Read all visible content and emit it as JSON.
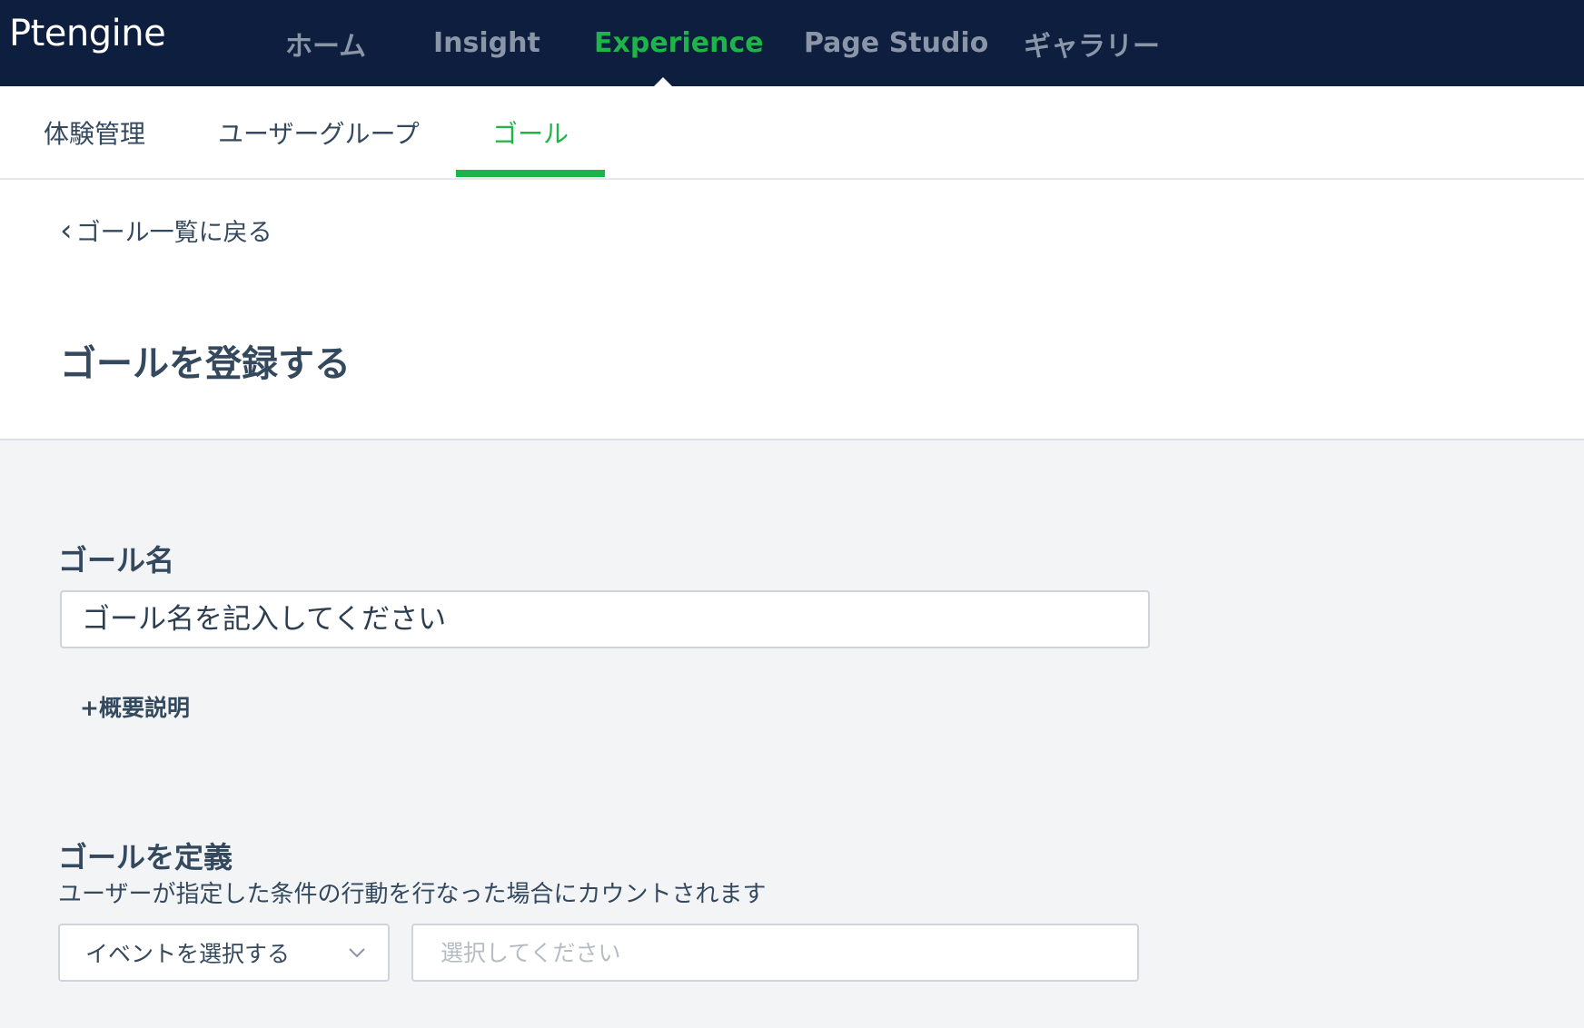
{
  "app": {
    "logo": "Ptengine"
  },
  "topnav": [
    "ホーム",
    "Insight",
    "Experience",
    "Page Studio",
    "ギャラリー"
  ],
  "subnav": [
    "体験管理",
    "ユーザーグループ",
    "ゴール"
  ],
  "back_link": "ゴール一覧に戻る",
  "page_title": "ゴールを登録する",
  "goal_name": {
    "label": "ゴール名",
    "placeholder": "ゴール名を記入してください",
    "value": ""
  },
  "description_link": "+概要説明",
  "goal_definition": {
    "label": "ゴールを定義",
    "help": "ユーザーが指定した条件の行動を行なった場合にカウントされます",
    "event_select": "イベントを選択する",
    "value_placeholder": "選択してください"
  },
  "colors": {
    "nav_bg": "#0d1e3e",
    "accent": "#1eb548",
    "text": "#34495e",
    "page_bg": "#f3f4f6"
  }
}
